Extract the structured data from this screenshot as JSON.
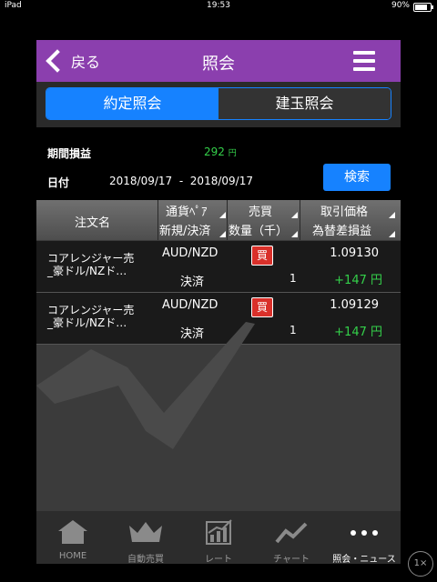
{
  "status": {
    "device": "iPad",
    "time": "19:53",
    "battery": "90%"
  },
  "nav": {
    "back_label": "戻る",
    "title": "照会"
  },
  "segments": [
    {
      "label": "約定照会",
      "active": true
    },
    {
      "label": "建玉照会",
      "active": false
    }
  ],
  "filter": {
    "pnl_label": "期間損益",
    "pnl_value": "292",
    "pnl_unit": "円",
    "date_label": "日付",
    "date_from": "2018/09/17",
    "date_sep": "-",
    "date_to": "2018/09/17",
    "search_label": "検索"
  },
  "table": {
    "col_order_name": "注文名",
    "col_pair": "通貨ﾍﾟｱ",
    "col_new_settle": "新規/決済",
    "col_side": "売買",
    "col_qty": "数量（千）",
    "col_price": "取引価格",
    "col_fx_pl": "為替差損益",
    "rows": [
      {
        "name_line1": "コアレンジャー売",
        "name_line2": "_豪ドル/NZド…",
        "pair": "AUD/NZD",
        "side": "買",
        "price": "1.09130",
        "type": "決済",
        "qty": "1",
        "pl": "+147 円"
      },
      {
        "name_line1": "コアレンジャー売",
        "name_line2": "_豪ドル/NZド…",
        "pair": "AUD/NZD",
        "side": "買",
        "price": "1.09129",
        "type": "決済",
        "qty": "1",
        "pl": "+147 円"
      }
    ]
  },
  "tabs": [
    {
      "label": "HOME",
      "icon": "home-icon"
    },
    {
      "label": "自動売買",
      "icon": "crown-icon"
    },
    {
      "label": "レート",
      "icon": "rate-chart-icon"
    },
    {
      "label": "チャート",
      "icon": "line-chart-icon"
    },
    {
      "label": "照会・ニュース",
      "icon": "more-dots-icon"
    }
  ],
  "zoom_label": "1×",
  "colors": {
    "accent_purple": "#8b3fae",
    "accent_blue": "#1682ff",
    "profit_green": "#34d04a",
    "buy_red": "#d9302a"
  }
}
